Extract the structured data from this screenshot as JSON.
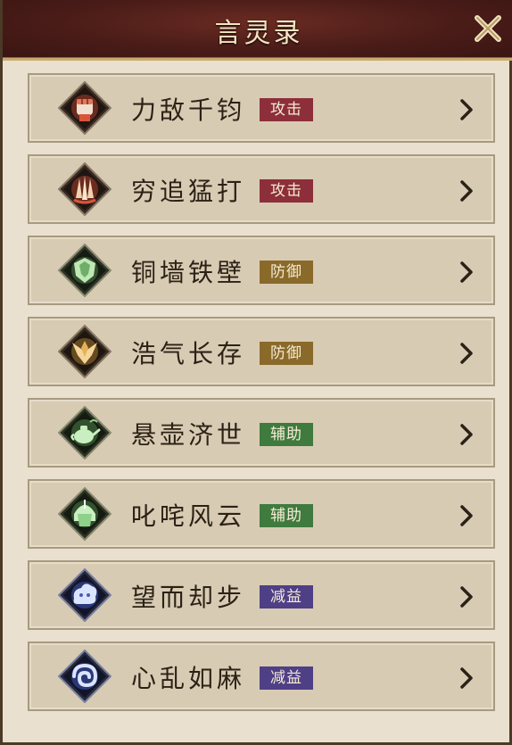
{
  "window": {
    "title": "言灵录"
  },
  "items": [
    {
      "name": "力敌千钧",
      "tag": "攻击",
      "tag_type": "atk",
      "icon": "fist-icon"
    },
    {
      "name": "穷追猛打",
      "tag": "攻击",
      "tag_type": "atk",
      "icon": "claw-icon"
    },
    {
      "name": "铜墙铁壁",
      "tag": "防御",
      "tag_type": "def",
      "icon": "shield-crest-icon"
    },
    {
      "name": "浩气长存",
      "tag": "防御",
      "tag_type": "def",
      "icon": "winged-crest-icon"
    },
    {
      "name": "悬壶济世",
      "tag": "辅助",
      "tag_type": "sup",
      "icon": "teapot-icon"
    },
    {
      "name": "叱咤风云",
      "tag": "辅助",
      "tag_type": "sup",
      "icon": "helmet-icon"
    },
    {
      "name": "望而却步",
      "tag": "减益",
      "tag_type": "deb",
      "icon": "cloud-fear-icon"
    },
    {
      "name": "心乱如麻",
      "tag": "减益",
      "tag_type": "deb",
      "icon": "swirl-icon"
    }
  ],
  "colors": {
    "atk": "#8c2f3a",
    "def": "#8a6a2a",
    "sup": "#3f7a3f",
    "deb": "#4e3f86",
    "atk_icon": "#d9553a",
    "def_icon_green": "#7fc07a",
    "def_icon_gold": "#e3b25a",
    "sup_icon": "#8fd08a",
    "deb_icon": "#8aa4ff"
  }
}
